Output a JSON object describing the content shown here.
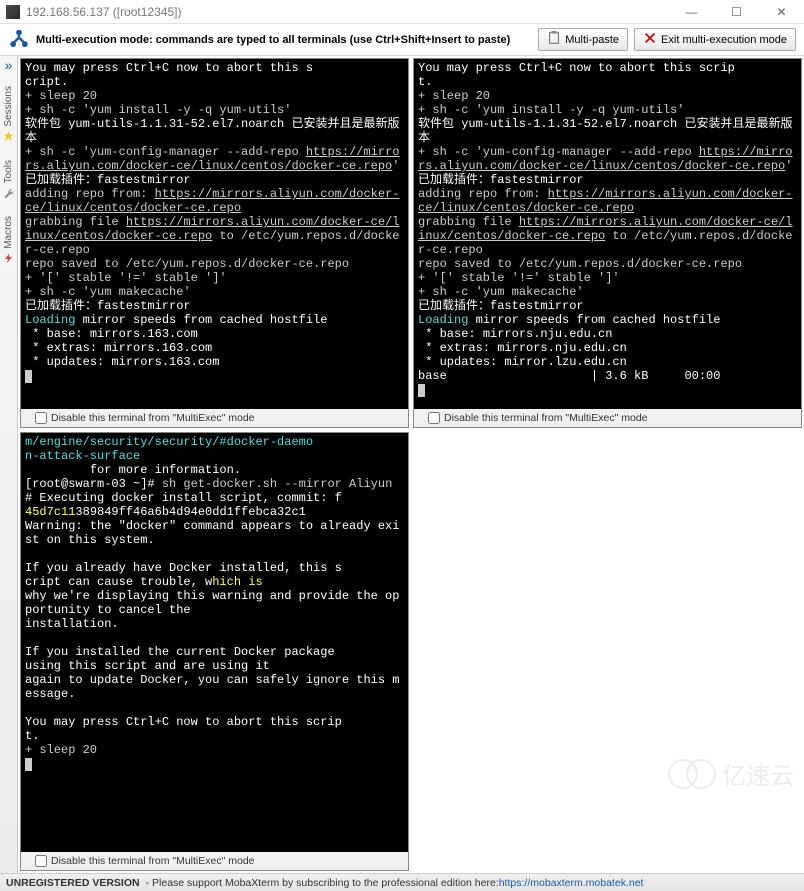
{
  "window": {
    "title": "192.168.56.137 ([root12345])"
  },
  "multibar": {
    "message": "Multi-execution mode: commands are typed to all terminals (use Ctrl+Shift+Insert to paste)",
    "paste_label": "Multi-paste",
    "exit_label": "Exit multi-execution mode"
  },
  "sidebar": {
    "tabs": [
      {
        "label": "Sessions"
      },
      {
        "label": "Tools"
      },
      {
        "label": "Macros"
      }
    ]
  },
  "terminals": {
    "disable_label": "Disable this terminal from \"MultiExec\" mode",
    "t1": {
      "l1": "You may press Ctrl+C now to abort this s",
      "l2": "cript.",
      "l3": "+ sleep 20",
      "l4": "+ sh -c 'yum install -y -q yum-utils'",
      "l5": "软件包 yum-utils-1.1.31-52.el7.noarch 已安装并且是最新版本",
      "l6a": "+ sh -c 'yum-config-manager --add-repo ",
      "l6b": "https://mirrors.aliyun.com/docker-ce/linux/centos/docker-ce.repo",
      "l6c": "'",
      "l7": "已加载插件：fastestmirror",
      "l8a": "adding repo from: ",
      "l8b": "https://mirrors.aliyun.com/docker-ce/linux/centos/docker-ce.repo",
      "l9a": "grabbing file ",
      "l9b": "https://mirrors.aliyun.com/docker-ce/linux/centos/docker-ce.repo",
      "l9c": " to /etc/yum.repos.d/docker-ce.repo",
      "l10": "repo saved to /etc/yum.repos.d/docker-ce.repo",
      "l11": "+ '[' stable '!=' stable ']'",
      "l12": "+ sh -c 'yum makecache'",
      "l13": "已加载插件：fastestmirror",
      "l14a": "Loading",
      "l14b": " mirror speeds from cached hostfile",
      "l15": " * base: mirrors.163.com",
      "l16": " * extras: mirrors.163.com",
      "l17": " * updates: mirrors.163.com"
    },
    "t2": {
      "l1": "You may press Ctrl+C now to abort this scrip",
      "l2": "t.",
      "l3": "+ sleep 20",
      "l4": "+ sh -c 'yum install -y -q yum-utils'",
      "l5": "软件包 yum-utils-1.1.31-52.el7.noarch 已安装并且是最新版本",
      "l6a": "+ sh -c 'yum-config-manager --add-repo ",
      "l6b": "https://mirrors.aliyun.com/docker-ce/linux/centos/docker-ce.repo",
      "l6c": "'",
      "l7": "已加载插件：fastestmirror",
      "l8a": "adding repo from: ",
      "l8b": "https://mirrors.aliyun.com/docker-ce/linux/centos/docker-ce.repo",
      "l9a": "grabbing file ",
      "l9b": "https://mirrors.aliyun.com/docker-ce/linux/centos/docker-ce.repo",
      "l9c": " to /etc/yum.repos.d/docker-ce.repo",
      "l10": "repo saved to /etc/yum.repos.d/docker-ce.repo",
      "l11": "+ '[' stable '!=' stable ']'",
      "l12": "+ sh -c 'yum makecache'",
      "l13": "已加载插件：fastestmirror",
      "l14a": "Loading",
      "l14b": " mirror speeds from cached hostfile",
      "l15": " * base: mirrors.nju.edu.cn",
      "l16": " * extras: mirrors.nju.edu.cn",
      "l17": " * updates: mirror.lzu.edu.cn",
      "l18": "base                    | 3.6 kB     00:00"
    },
    "t3": {
      "l1": "m/engine/security/security/#docker-daemo",
      "l2": "n-attack-surface",
      "l3": "         for more information.",
      "l4a": "[root@swarm-03 ~]# ",
      "l4b": "sh get-docker.sh --mirror Aliyun",
      "l5a": "# Executing docker install script, commit: f",
      "l5b": "45d7c11",
      "l5c": "389849ff46a6b4d94e0dd1ffebca32c1",
      "l6": "Warning: the \"docker\" command appears to already exist on this system.",
      "l7": "",
      "l8": "If you already have Docker installed, this s",
      "l9a": "cript can cause trouble, w",
      "l9b": "hich is",
      "l10": "why we're displaying this warning and provide the opportunity to cancel the",
      "l11": "installation.",
      "l12": "",
      "l13": "If you installed the current Docker package",
      "l14": "using this script and are using it",
      "l15": "again to update Docker, you can safely ignore this message.",
      "l16": "",
      "l17": "You may press Ctrl+C now to abort this scrip",
      "l18": "t.",
      "l19": "+ sleep 20"
    }
  },
  "status": {
    "version": "UNREGISTERED VERSION",
    "msg": " -  Please support MobaXterm by subscribing to the professional edition here:  ",
    "url": "https://mobaxterm.mobatek.net"
  },
  "watermark": "亿速云"
}
